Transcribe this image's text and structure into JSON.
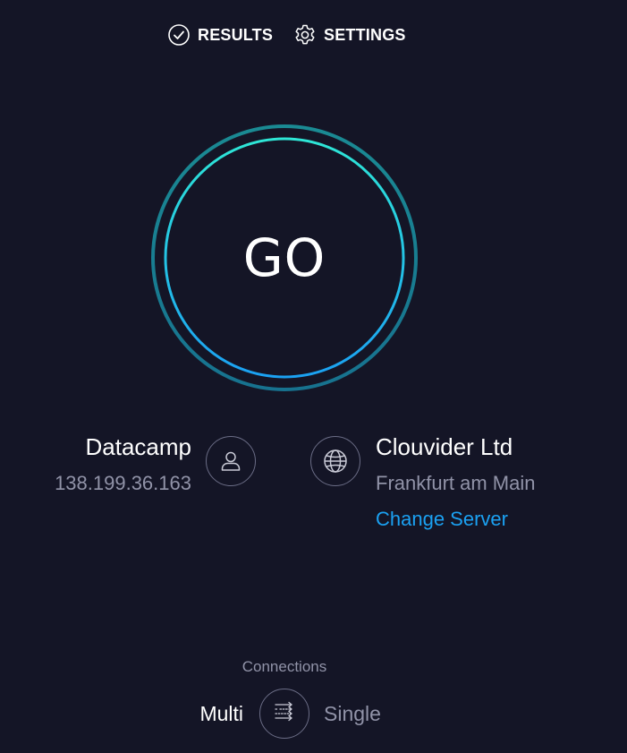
{
  "nav": {
    "results_label": "RESULTS",
    "results_icon": "check-circle-icon",
    "settings_label": "SETTINGS",
    "settings_icon": "gear-icon"
  },
  "go_button": {
    "label": "GO",
    "ring_colors": [
      "#2ee6d6",
      "#1ba1f2"
    ]
  },
  "provider": {
    "name": "Datacamp",
    "ip": "138.199.36.163",
    "icon": "user-icon"
  },
  "server": {
    "name": "Clouvider Ltd",
    "location": "Frankfurt am Main",
    "change_label": "Change Server",
    "icon": "globe-icon"
  },
  "connections": {
    "title": "Connections",
    "multi_label": "Multi",
    "single_label": "Single",
    "selected": "Multi",
    "icon": "multi-connection-icon"
  },
  "colors": {
    "background": "#141526",
    "accent_link": "#1ba1f2",
    "muted_text": "#9193a8"
  }
}
